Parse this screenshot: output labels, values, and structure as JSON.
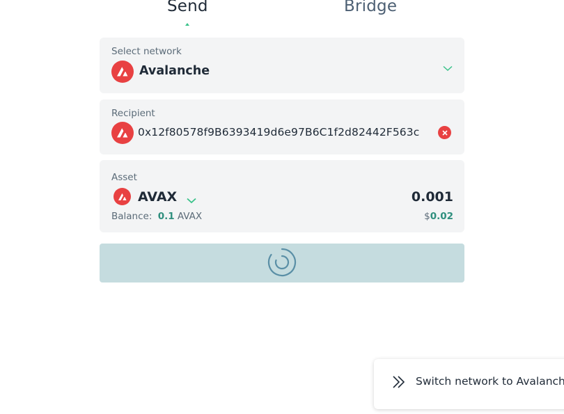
{
  "tabs": {
    "send_label": "Send",
    "bridge_label": "Bridge",
    "active": "Send"
  },
  "network": {
    "label": "Select network",
    "value": "Avalanche",
    "icon": "avalanche-logo-icon"
  },
  "recipient": {
    "label": "Recipient",
    "address": "0x12f80578f9B6393419d6e97B6C1f2d82442F563c",
    "icon": "avalanche-logo-icon",
    "clear_icon": "close-icon"
  },
  "asset": {
    "label": "Asset",
    "symbol": "AVAX",
    "amount": "0.001",
    "balance_label": "Balance:",
    "balance_value": "0.1",
    "balance_unit": "AVAX",
    "usd_prefix": "$",
    "usd_value": "0.02"
  },
  "submit": {
    "state": "loading",
    "icon": "spinner-icon"
  },
  "toast": {
    "text": "Switch network to Avalanche",
    "icon": "double-chevron-right-icon"
  },
  "colors": {
    "accent": "#3ac28a",
    "avalanche_red": "#e84142",
    "value_teal": "#2f8f7e",
    "button_bg": "#c5dcdf",
    "spinner": "#5a8fa6",
    "card_bg": "#f3f4f5"
  }
}
